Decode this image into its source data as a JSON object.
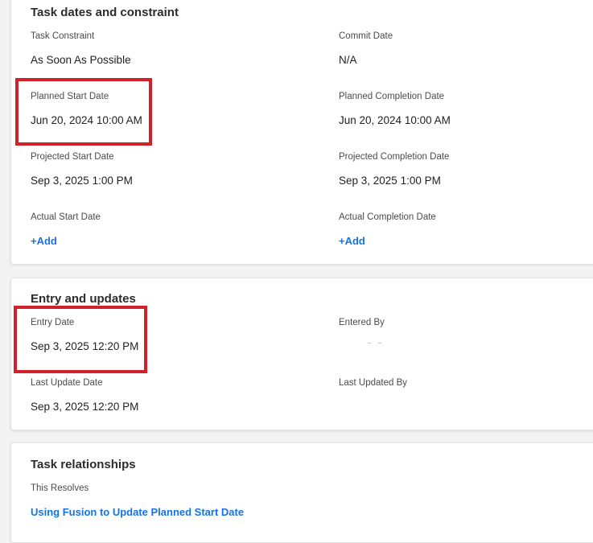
{
  "task_dates": {
    "title": "Task dates and constraint",
    "task_constraint_label": "Task Constraint",
    "task_constraint_value": "As Soon As Possible",
    "commit_date_label": "Commit Date",
    "commit_date_value": "N/A",
    "planned_start_label": "Planned Start Date",
    "planned_start_value": "Jun 20, 2024 10:00 AM",
    "planned_completion_label": "Planned Completion Date",
    "planned_completion_value": "Jun 20, 2024 10:00 AM",
    "projected_start_label": "Projected Start Date",
    "projected_start_value": "Sep 3, 2025 1:00 PM",
    "projected_completion_label": "Projected Completion Date",
    "projected_completion_value": "Sep 3, 2025 1:00 PM",
    "actual_start_label": "Actual Start Date",
    "actual_start_add": "+Add",
    "actual_completion_label": "Actual Completion Date",
    "actual_completion_add": "+Add"
  },
  "entry_updates": {
    "title": "Entry and updates",
    "entry_date_label": "Entry Date",
    "entry_date_value": "Sep 3, 2025 12:20 PM",
    "entered_by_label": "Entered By",
    "last_update_label": "Last Update Date",
    "last_update_value": "Sep 3, 2025 12:20 PM",
    "last_updated_by_label": "Last Updated By"
  },
  "relationships": {
    "title": "Task relationships",
    "this_resolves_label": "This Resolves",
    "this_resolves_link": "Using Fusion to Update Planned Start Date"
  },
  "colors": {
    "link": "#1473e6",
    "highlight": "#d3212c"
  }
}
